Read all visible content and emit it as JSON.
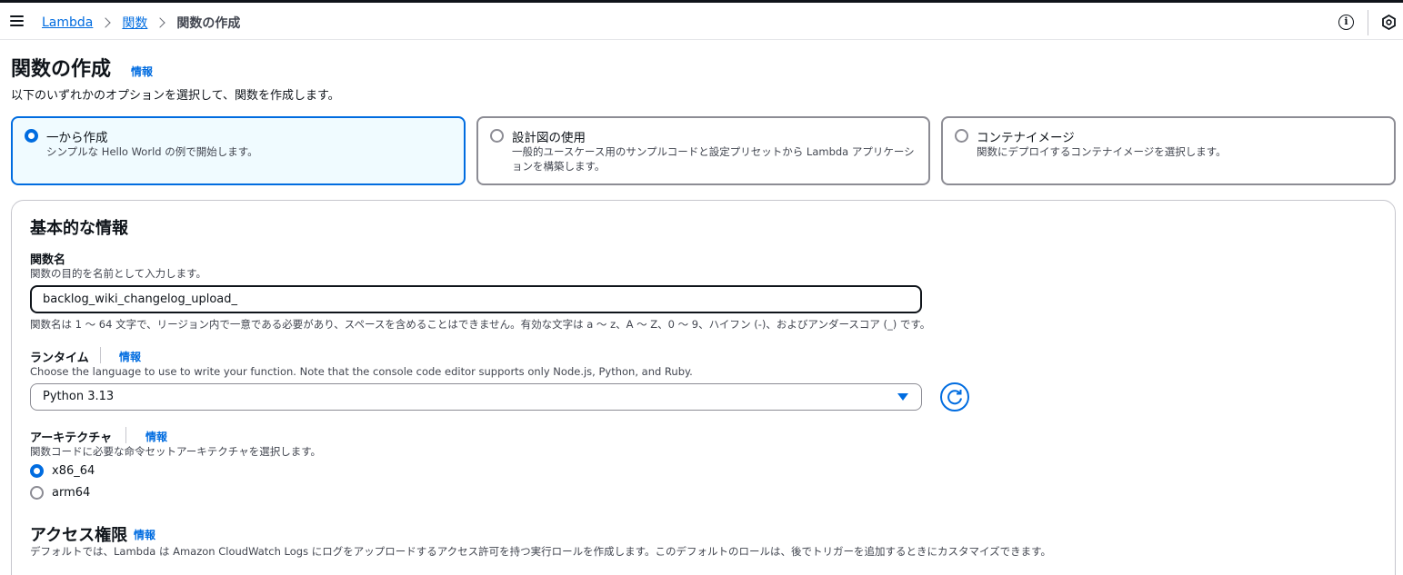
{
  "breadcrumb": {
    "items": [
      "Lambda",
      "関数"
    ],
    "current": "関数の作成"
  },
  "icons": {
    "menu": "hamburger-icon",
    "info": "info-icon",
    "settings": "hexagon-icon"
  },
  "header": {
    "title": "関数の作成",
    "info": "情報",
    "description": "以下のいずれかのオプションを選択して、関数を作成します。"
  },
  "options": [
    {
      "title": "一から作成",
      "description": "シンプルな Hello World の例で開始します。",
      "selected": true
    },
    {
      "title": "設計図の使用",
      "description": "一般的ユースケース用のサンプルコードと設定プリセットから Lambda アプリケーションを構築します。",
      "selected": false
    },
    {
      "title": "コンテナイメージ",
      "description": "関数にデプロイするコンテナイメージを選択します。",
      "selected": false
    }
  ],
  "basic": {
    "title": "基本的な情報",
    "function_name": {
      "label": "関数名",
      "description": "関数の目的を名前として入力します。",
      "value": "backlog_wiki_changelog_upload_",
      "constraint": "関数名は 1 〜 64 文字で、リージョン内で一意である必要があり、スペースを含めることはできません。有効な文字は a 〜 z、A 〜 Z、0 〜 9、ハイフン (-)、およびアンダースコア (_) です。"
    },
    "runtime": {
      "label": "ランタイム",
      "info": "情報",
      "description": "Choose the language to use to write your function. Note that the console code editor supports only Node.js, Python, and Ruby.",
      "value": "Python 3.13"
    },
    "architecture": {
      "label": "アーキテクチャ",
      "info": "情報",
      "description": "関数コードに必要な命令セットアーキテクチャを選択します。",
      "choices": [
        {
          "label": "x86_64",
          "selected": true
        },
        {
          "label": "arm64",
          "selected": false
        }
      ]
    },
    "permissions": {
      "title": "アクセス権限",
      "info": "情報",
      "description": "デフォルトでは、Lambda は Amazon CloudWatch Logs にログをアップロードするアクセス許可を持つ実行ロールを作成します。このデフォルトのロールは、後でトリガーを追加するときにカスタマイズできます。"
    }
  },
  "colors": {
    "accent": "#006ce0",
    "selected_bg": "#f0fbff",
    "border": "#8c8c94"
  }
}
